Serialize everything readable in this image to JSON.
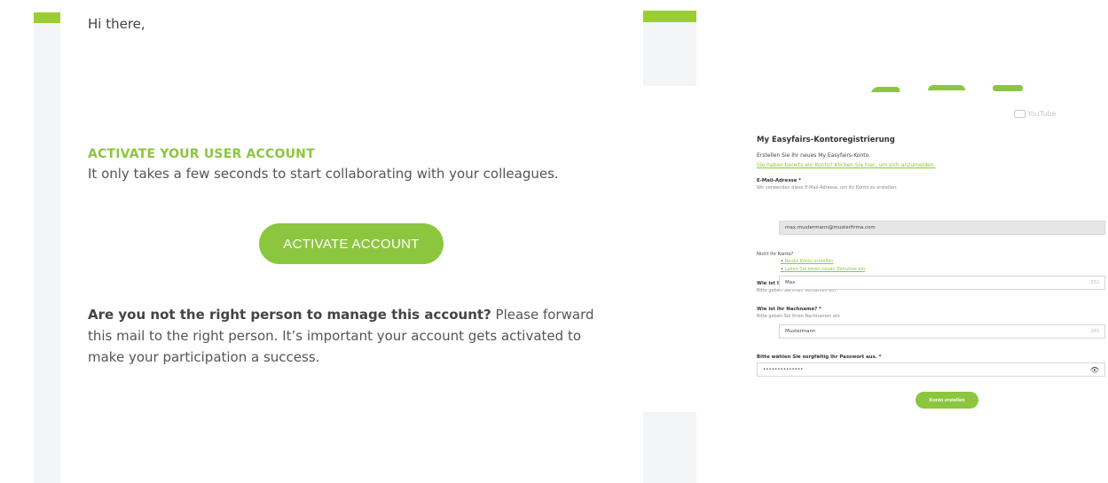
{
  "email": {
    "greeting": "Hi there,",
    "activate_title": "ACTIVATE YOUR USER ACCOUNT",
    "activate_subtitle": "It only takes a few seconds to start collaborating with your colleagues.",
    "activate_button": "ACTIVATE ACCOUNT",
    "not_right_bold": "Are you not the right person to manage this account?",
    "not_right_text": " Please forward this mail to the right person. It’s important your account gets activated to make your participation a success."
  },
  "video": {
    "youtube_label": "YouTube"
  },
  "form": {
    "title": "My Easyfairs-Kontoregistrierung",
    "subtitle": "Erstellen Sie Ihr neues My Easyfairs-Konto.",
    "login_link": "Sie haben bereits ein Konto? Klicken Sie hier, um sich anzumelden.",
    "email_label": "E-Mail-Adresse *",
    "email_help": "Wir verwenden diese E-Mail-Adresse, um Ihr Konto zu erstellen.",
    "email_value": "max.mustermann@musterfirma.com",
    "not_account": "Nicht Ihr Konto?",
    "bullet_new": "Neues Konto erstellen",
    "bullet_invite": "Laden Sie einen neuen Benutzer ein",
    "firstname_label": "Wie ist Ihr Vorname? *",
    "firstname_help": "Bitte geben Sie Ihren Vornamen ein",
    "firstname_value": "Max",
    "firstname_count": "252",
    "lastname_label": "Wie ist Ihr Nachname? *",
    "lastname_help": "Bitte geben Sie Ihren Nachnamen ein",
    "lastname_value": "Mustermann",
    "lastname_count": "245",
    "password_label": "Bitte wählen Sie sorgfältig Ihr Passwort aus. *",
    "password_value": "••••••••••••••",
    "submit_button": "Konto erstellen"
  },
  "colors": {
    "accent": "#8cc63f",
    "panel": "#f4f5f7"
  }
}
